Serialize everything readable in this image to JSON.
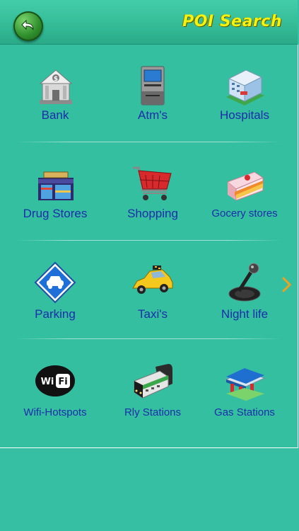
{
  "header": {
    "title": "POI Search",
    "back_icon": "back-arrow-icon"
  },
  "grid": {
    "rows": [
      [
        {
          "label": "Bank",
          "icon": "bank-icon"
        },
        {
          "label": "Atm's",
          "icon": "atm-icon"
        },
        {
          "label": "Hospitals",
          "icon": "hospital-icon"
        }
      ],
      [
        {
          "label": "Drug Stores",
          "icon": "drug-store-icon"
        },
        {
          "label": "Shopping",
          "icon": "shopping-cart-icon"
        },
        {
          "label": "Gocery stores",
          "icon": "grocery-store-icon"
        }
      ],
      [
        {
          "label": "Parking",
          "icon": "parking-icon"
        },
        {
          "label": "Taxi's",
          "icon": "taxi-icon"
        },
        {
          "label": "Night life",
          "icon": "microphone-icon"
        }
      ],
      [
        {
          "label": "Wifi-Hotspots",
          "icon": "wifi-icon"
        },
        {
          "label": "Rly Stations",
          "icon": "train-icon"
        },
        {
          "label": "Gas Stations",
          "icon": "gas-station-icon"
        }
      ]
    ]
  },
  "wifi_badge": {
    "left": "Wi",
    "right": "Fi"
  },
  "pager": {
    "next_icon": "chevron-right-icon"
  },
  "colors": {
    "background": "#36bfa3",
    "title": "#f2f213",
    "label": "#1a2dab",
    "back_button": "#2f8f2c"
  }
}
